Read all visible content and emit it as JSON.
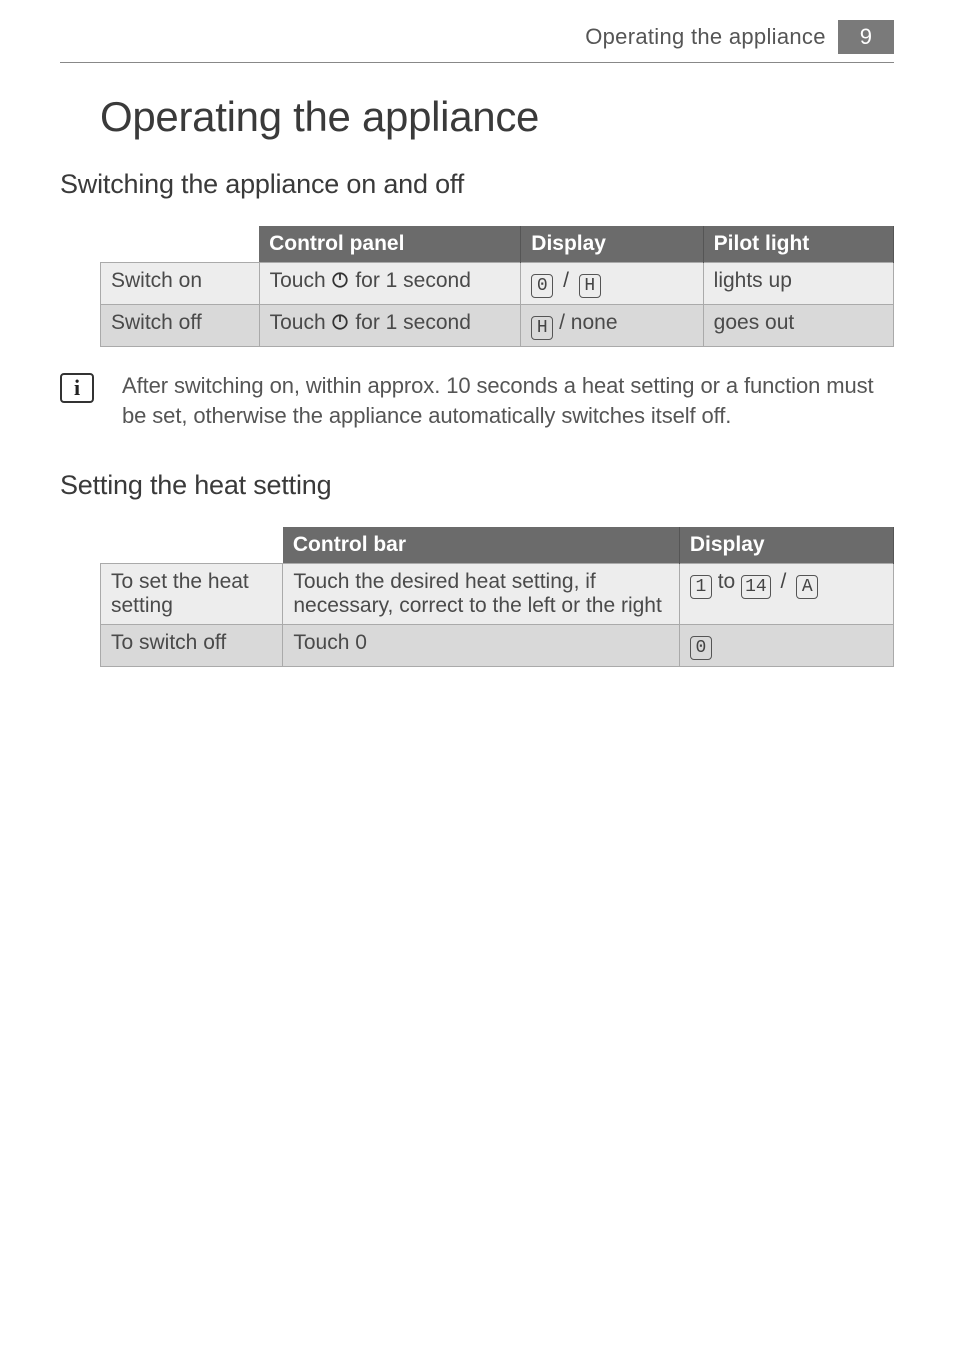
{
  "header": {
    "title": "Operating the appliance",
    "page_number": "9"
  },
  "main": {
    "heading": "Operating the appliance",
    "sections": [
      {
        "heading": "Switching the appliance on and off",
        "table1": {
          "head": {
            "c1": "",
            "c2": "Control panel",
            "c3": "Display",
            "c4": "Pilot light"
          },
          "rows": [
            {
              "label": "Switch on",
              "panel_prefix": "Touch ",
              "panel_suffix": " for 1 second",
              "disp_a": "0",
              "disp_sep": "/",
              "disp_b": "H",
              "pilot": "lights up"
            },
            {
              "label": "Switch off",
              "panel_prefix": "Touch ",
              "panel_suffix": " for 1 second",
              "disp_a": "H",
              "disp_suffix": " / none",
              "pilot": "goes out"
            }
          ]
        },
        "info": "After switching on, within approx. 10 seconds a heat setting or a function must be set, otherwise the appliance automatically switches itself off."
      },
      {
        "heading": "Setting the heat setting",
        "table2": {
          "head": {
            "c1": "",
            "c2": "Control bar",
            "c3": "Display"
          },
          "rows": [
            {
              "label": "To set the heat setting",
              "bar": "Touch the desired heat setting, if necessary, correct to the left or the right",
              "disp_a": "1",
              "disp_to": " to ",
              "disp_b": "14",
              "disp_sep": "/",
              "disp_c": "A"
            },
            {
              "label": "To switch off",
              "bar": "Touch 0",
              "disp_a": "0"
            }
          ]
        }
      }
    ]
  }
}
